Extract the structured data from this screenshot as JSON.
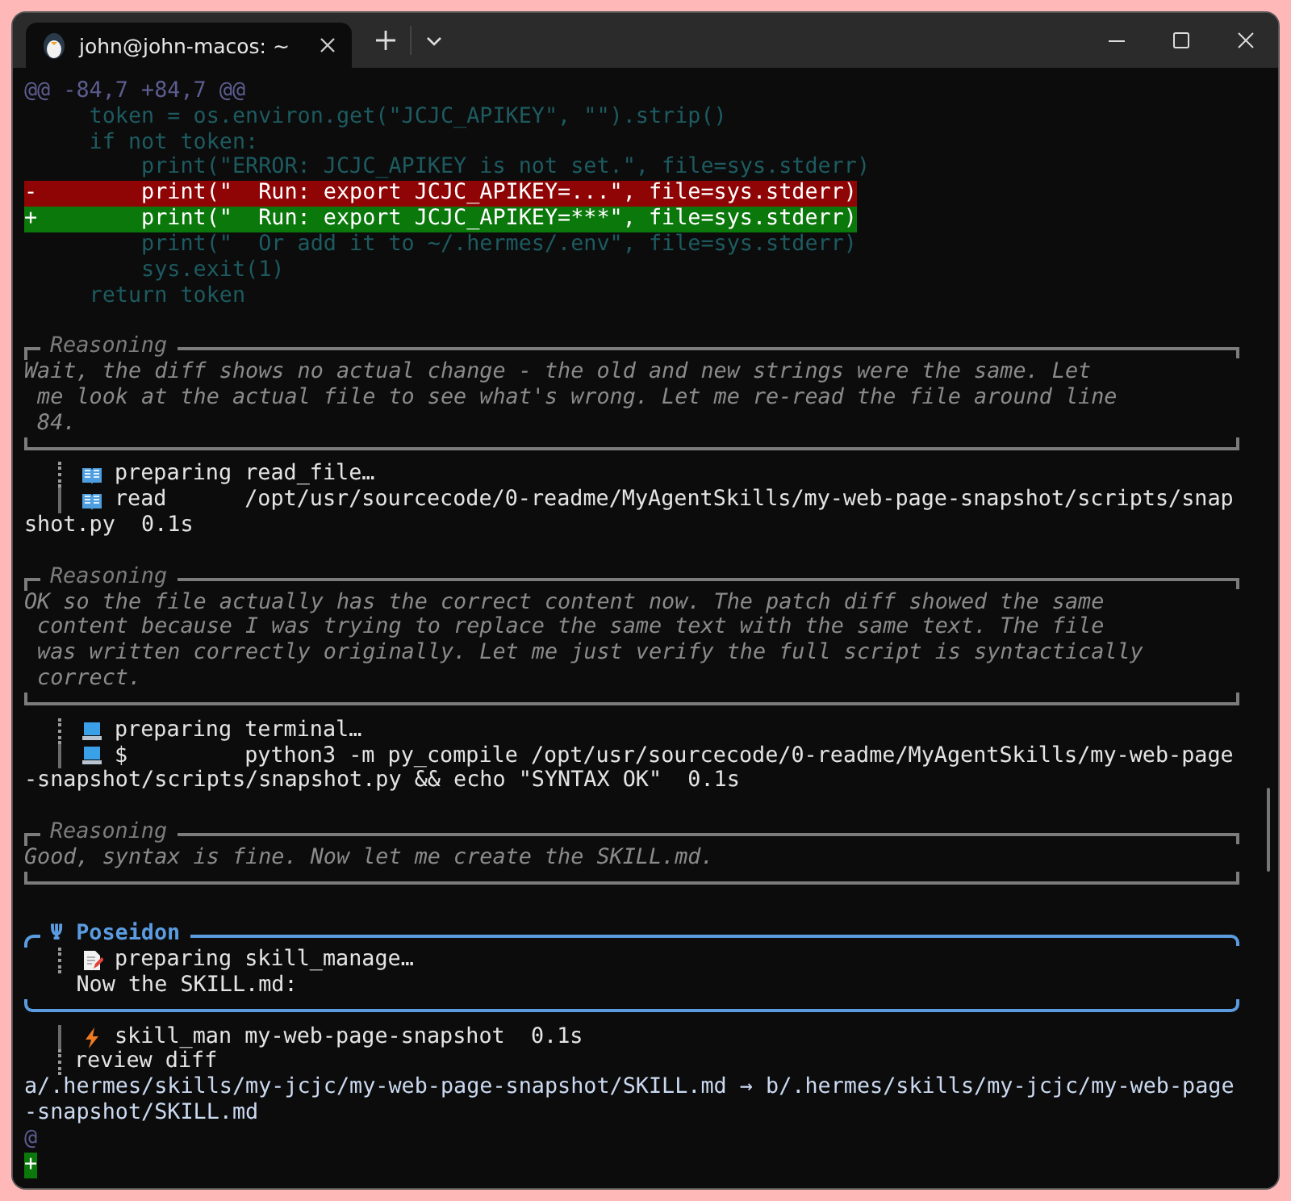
{
  "window": {
    "tab": {
      "title": "john@john-macos: ~",
      "selected": true
    }
  },
  "lines": [
    {
      "kind": "hunk",
      "text": "@@ -84,7 +84,7 @@"
    },
    {
      "kind": "context",
      "text": "     token = os.environ.get(\"JCJC_APIKEY\", \"\").strip()"
    },
    {
      "kind": "context",
      "text": "     if not token:"
    },
    {
      "kind": "context",
      "text": "         print(\"ERROR: JCJC_APIKEY is not set.\", file=sys.stderr)"
    },
    {
      "kind": "removed",
      "text": "-        print(\"  Run: export JCJC_APIKEY=...\", file=sys.stderr)"
    },
    {
      "kind": "added",
      "text": "+        print(\"  Run: export JCJC_APIKEY=***\", file=sys.stderr)"
    },
    {
      "kind": "context",
      "text": "         print(\"  Or add it to ~/.hermes/.env\", file=sys.stderr)"
    },
    {
      "kind": "context",
      "text": "         sys.exit(1)"
    },
    {
      "kind": "context",
      "text": "     return token"
    },
    {
      "kind": "blank"
    },
    {
      "kind": "reasoning",
      "title": "Reasoning",
      "lines": [
        "Wait, the diff shows no actual change - the old and new strings were the same. Let",
        " me look at the actual file to see what's wrong. Let me re-read the file around line",
        " 84."
      ]
    },
    {
      "kind": "read",
      "pending": true,
      "text": "preparing read_file…"
    },
    {
      "kind": "read",
      "pending": false,
      "text": "read      /opt/usr/sourcecode/0-readme/MyAgentSkills/my-web-page-snapshot/scripts/snap"
    },
    {
      "kind": "plain",
      "text": "shot.py  0.1s"
    },
    {
      "kind": "blank"
    },
    {
      "kind": "reasoning",
      "title": "Reasoning",
      "lines": [
        "OK so the file actually has the correct content now. The patch diff showed the same",
        " content because I was trying to replace the same text with the same text. The file",
        " was written correctly originally. Let me just verify the full script is syntactically",
        " correct."
      ]
    },
    {
      "kind": "shell",
      "pending": true,
      "text": "preparing terminal…"
    },
    {
      "kind": "shell",
      "pending": false,
      "text": "$         python3 -m py_compile /opt/usr/sourcecode/0-readme/MyAgentSkills/my-web-page"
    },
    {
      "kind": "plain",
      "text": "-snapshot/scripts/snapshot.py && echo \"SYNTAX OK\"  0.1s"
    },
    {
      "kind": "blank"
    },
    {
      "kind": "reasoning",
      "title": "Reasoning",
      "lines": [
        "Good, syntax is fine. Now let me create the SKILL.md."
      ]
    },
    {
      "kind": "blank"
    },
    {
      "kind": "agent",
      "title": "Ψ Poseidon",
      "children": [
        {
          "kind": "edit",
          "pending": true,
          "text": "preparing skill_manage…"
        },
        {
          "kind": "plain",
          "text": "    Now the SKILL.md:"
        }
      ]
    },
    {
      "kind": "run",
      "pending": false,
      "text": "skill_man my-web-page-snapshot  0.1s"
    },
    {
      "kind": "note",
      "pending": true,
      "text": "review diff"
    },
    {
      "kind": "path",
      "text": "a/.hermes/skills/my-jcjc/my-web-page-snapshot/SKILL.md → b/.hermes/skills/my-jcjc/my-web-page"
    },
    {
      "kind": "path",
      "text": "-snapshot/SKILL.md"
    },
    {
      "kind": "hunk",
      "text": "@"
    },
    {
      "kind": "added",
      "text": "+"
    }
  ]
}
